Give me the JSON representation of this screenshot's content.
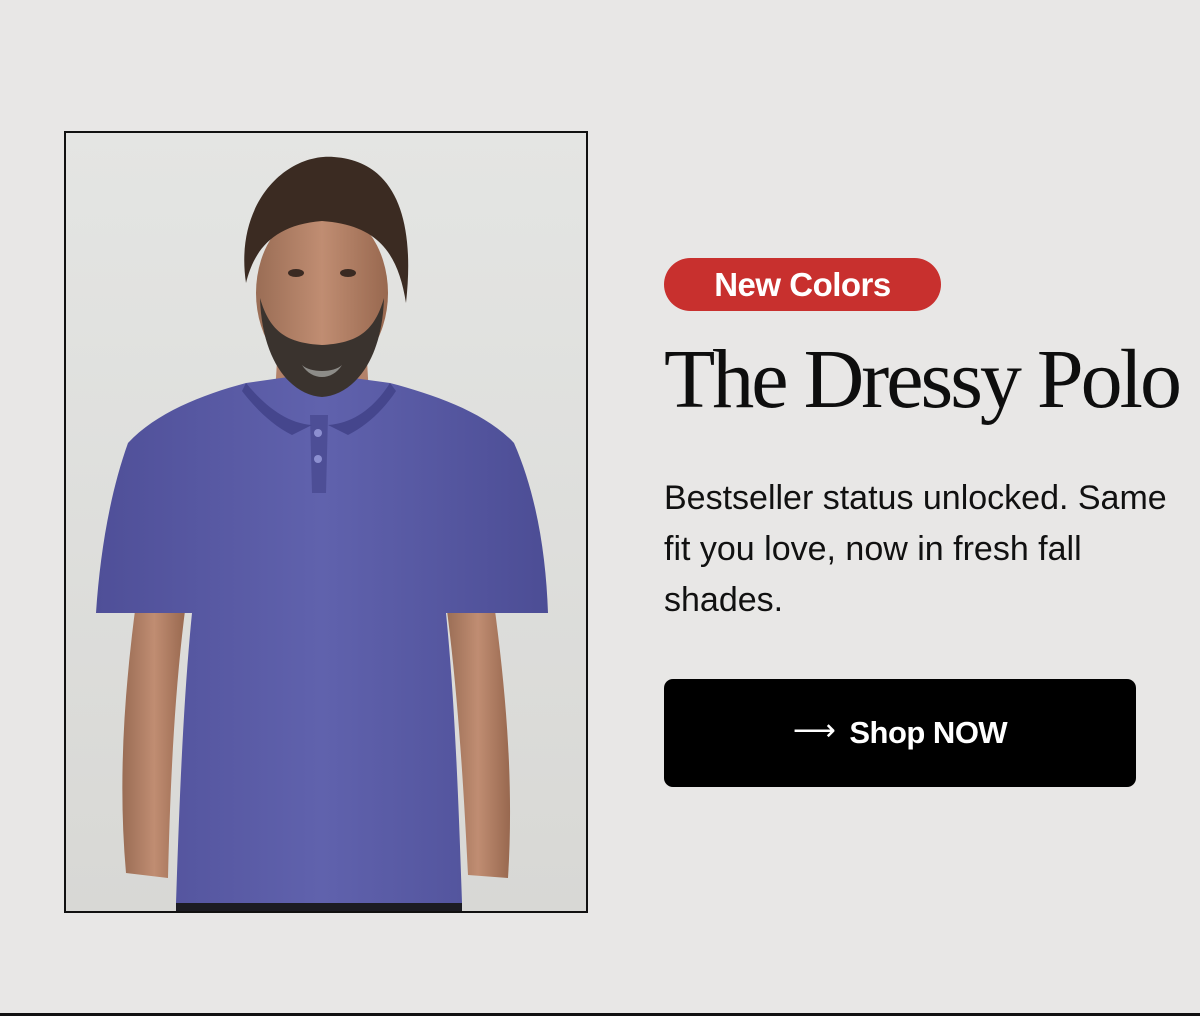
{
  "promo": {
    "badge": "New Colors",
    "title": "The Dressy Polo",
    "description": "Bestseller status unlocked. Same fit you love, now in fresh fall shades.",
    "cta_label": "Shop NOW",
    "cta_icon": "arrow-right-icon"
  },
  "colors": {
    "background": "#e8e7e6",
    "badge_bg": "#c8302e",
    "button_bg": "#000000",
    "polo": "#5a5ba6"
  }
}
